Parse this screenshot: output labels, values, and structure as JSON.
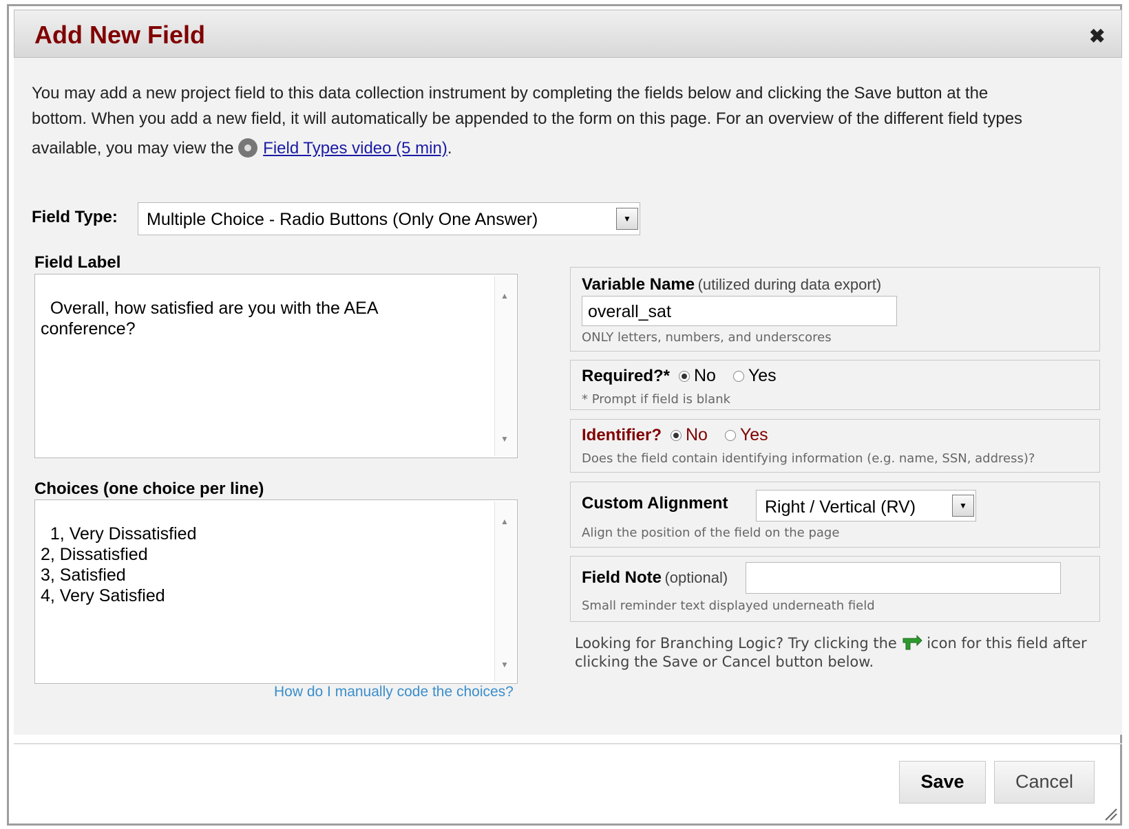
{
  "dialog": {
    "title": "Add New Field",
    "close_symbol": "✖",
    "intro_line1": "You may add a new project field to this data collection instrument by completing the fields below and clicking the Save button at the",
    "intro_line2": "bottom. When you add a new field, it will automatically be appended to the form on this page. For an overview of the different field types",
    "intro_line3_prefix": "available, you may view the",
    "video_link": "Field Types video (5 min)",
    "intro_line3_suffix": ".",
    "video_icon": "film-reel-icon"
  },
  "field_type": {
    "label": "Field Type:",
    "value": "Multiple Choice - Radio Buttons (Only One Answer)"
  },
  "field_label": {
    "label": "Field Label",
    "value": "Overall, how satisfied are you with the AEA\nconference?"
  },
  "choices": {
    "label": "Choices (one choice per line)",
    "value": "1, Very Dissatisfied\n2, Dissatisfied\n3, Satisfied\n4, Very Satisfied",
    "help_link": "How do I manually code the choices?"
  },
  "variable_name": {
    "label": "Variable Name",
    "note": "(utilized during data export)",
    "value": "overall_sat",
    "hint": "ONLY letters, numbers, and underscores"
  },
  "required": {
    "label": "Required?*",
    "option_no": "No",
    "option_yes": "Yes",
    "selected": "No",
    "hint": "* Prompt if field is blank"
  },
  "identifier": {
    "label": "Identifier?",
    "option_no": "No",
    "option_yes": "Yes",
    "selected": "No",
    "hint": "Does the field contain identifying information (e.g. name, SSN, address)?",
    "color": "#800000"
  },
  "custom_alignment": {
    "label": "Custom Alignment",
    "value": "Right / Vertical (RV)",
    "hint": "Align the position of the field on the page"
  },
  "field_note": {
    "label": "Field Note",
    "note": "(optional)",
    "value": "",
    "hint": "Small reminder text displayed underneath field"
  },
  "branching": {
    "text_prefix": "Looking for Branching Logic? Try clicking the",
    "text_suffix": "icon for this field after",
    "line2": "clicking the Save or Cancel button below.",
    "icon": "branching-arrow-icon"
  },
  "footer": {
    "save_label": "Save",
    "cancel_label": "Cancel"
  },
  "colors": {
    "title": "#800000",
    "link": "#1a1aa6",
    "help_link": "#3a8ecb",
    "panel_bg": "#f2f2f2"
  }
}
